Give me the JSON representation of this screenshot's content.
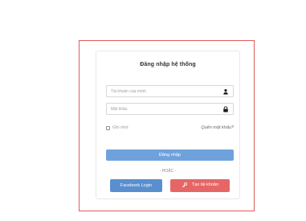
{
  "login_form": {
    "title": "Đăng nhập hệ thống",
    "username_placeholder": "Tài khoản của mình",
    "password_placeholder": "Mật khẩu",
    "remember_label": "Ghi nhớ",
    "forgot_password_label": "Quên mật khẩu?",
    "login_button_label": "Đăng nhập",
    "or_label": "- HOẶC -",
    "facebook_button_label": "Facebook Login",
    "register_button_label": "Tạo tài khoản"
  },
  "colors": {
    "frame_border": "#e05a5a",
    "login_button": "#6fa2dd",
    "facebook_button": "#5a8fcf",
    "register_button": "#e66666"
  },
  "icons": {
    "username": "user-icon",
    "password": "lock-icon",
    "register": "key-icon"
  }
}
